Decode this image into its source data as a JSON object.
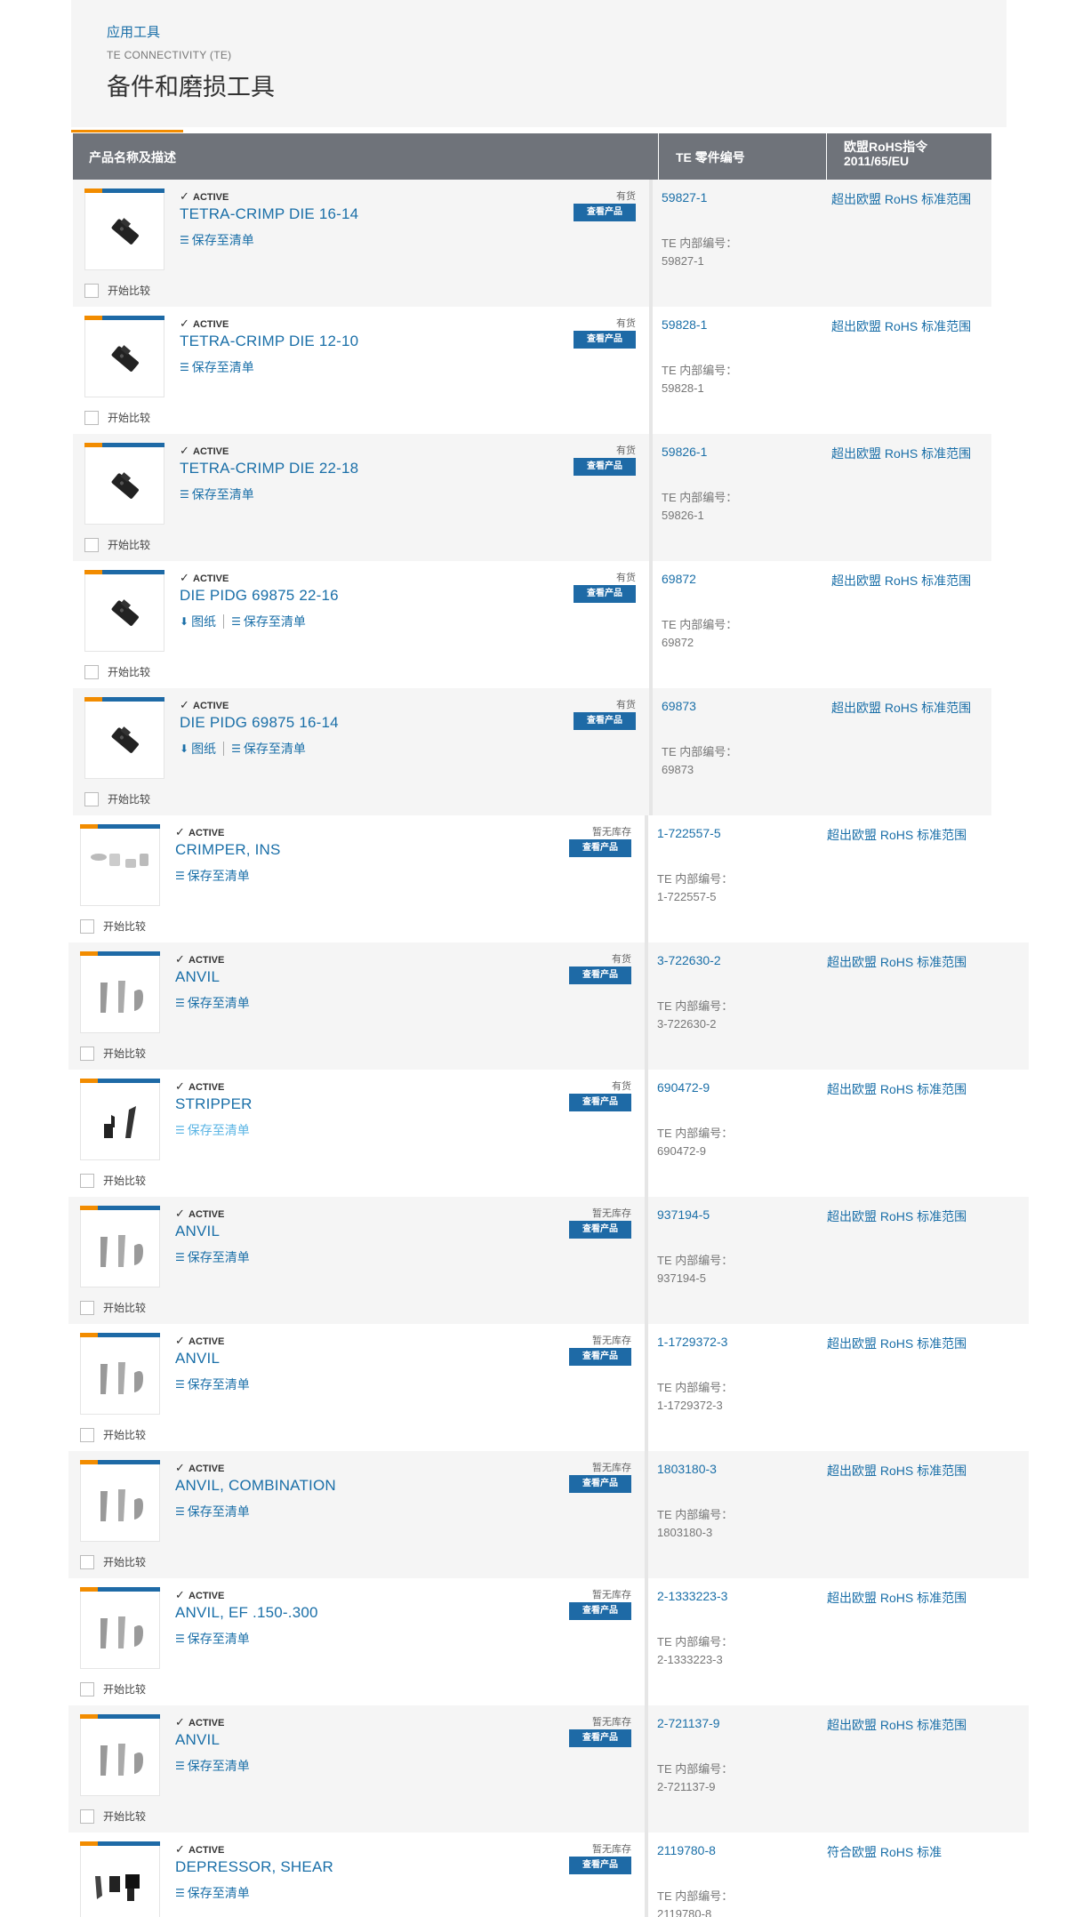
{
  "header": {
    "breadcrumb": "应用工具",
    "brand": "TE CONNECTIVITY (TE)",
    "title": "备件和磨损工具"
  },
  "table": {
    "col_product": "产品名称及描述",
    "col_part": "TE 零件编号",
    "col_rohs_line1": "欧盟RoHS指令",
    "col_rohs_line2": "2011/65/EU"
  },
  "common": {
    "status": "ACTIVE",
    "view_button": "查看产品",
    "save_to_list": "保存至清单",
    "drawing": "图纸",
    "compare": "开始比较",
    "internal_label": "TE 内部编号："
  },
  "rows": [
    {
      "name": "TETRA-CRIMP DIE 16-14",
      "stock": "有货",
      "part": "59827-1",
      "internal": "59827-1",
      "rohs": "超出欧盟 RoHS 标准范围",
      "image": "die-icon",
      "drawing": false
    },
    {
      "name": "TETRA-CRIMP DIE 12-10",
      "stock": "有货",
      "part": "59828-1",
      "internal": "59828-1",
      "rohs": "超出欧盟 RoHS 标准范围",
      "image": "die-icon",
      "drawing": false
    },
    {
      "name": "TETRA-CRIMP DIE 22-18",
      "stock": "有货",
      "part": "59826-1",
      "internal": "59826-1",
      "rohs": "超出欧盟 RoHS 标准范围",
      "image": "die-icon",
      "drawing": false
    },
    {
      "name": "DIE PIDG 69875 22-16",
      "stock": "有货",
      "part": "69872",
      "internal": "69872",
      "rohs": "超出欧盟 RoHS 标准范围",
      "image": "die-icon",
      "drawing": true
    },
    {
      "name": "DIE PIDG 69875 16-14",
      "stock": "有货",
      "part": "69873",
      "internal": "69873",
      "rohs": "超出欧盟 RoHS 标准范围",
      "image": "die-icon",
      "drawing": true
    },
    {
      "name": "CRIMPER, INS",
      "stock": "暂无库存",
      "part": "1-722557-5",
      "internal": "1-722557-5",
      "rohs": "超出欧盟 RoHS 标准范围",
      "image": "crimper-parts-icon",
      "drawing": false
    },
    {
      "name": "ANVIL",
      "stock": "有货",
      "part": "3-722630-2",
      "internal": "3-722630-2",
      "rohs": "超出欧盟 RoHS 标准范围",
      "image": "anvil-icon",
      "drawing": false
    },
    {
      "name": "STRIPPER",
      "stock": "有货",
      "part": "690472-9",
      "internal": "690472-9",
      "rohs": "超出欧盟 RoHS 标准范围",
      "image": "stripper-icon",
      "drawing": false
    },
    {
      "name": "ANVIL",
      "stock": "暂无库存",
      "part": "937194-5",
      "internal": "937194-5",
      "rohs": "超出欧盟 RoHS 标准范围",
      "image": "anvil-icon",
      "drawing": false
    },
    {
      "name": "ANVIL",
      "stock": "暂无库存",
      "part": "1-1729372-3",
      "internal": "1-1729372-3",
      "rohs": "超出欧盟 RoHS 标准范围",
      "image": "anvil-icon",
      "drawing": false
    },
    {
      "name": "ANVIL, COMBINATION",
      "stock": "暂无库存",
      "part": "1803180-3",
      "internal": "1803180-3",
      "rohs": "超出欧盟 RoHS 标准范围",
      "image": "anvil-icon",
      "drawing": false
    },
    {
      "name": "ANVIL, EF .150-.300",
      "stock": "暂无库存",
      "part": "2-1333223-3",
      "internal": "2-1333223-3",
      "rohs": "超出欧盟 RoHS 标准范围",
      "image": "anvil-icon",
      "drawing": false
    },
    {
      "name": "ANVIL",
      "stock": "暂无库存",
      "part": "2-721137-9",
      "internal": "2-721137-9",
      "rohs": "超出欧盟 RoHS 标准范围",
      "image": "anvil-icon",
      "drawing": false
    },
    {
      "name": "DEPRESSOR, SHEAR",
      "stock": "暂无库存",
      "part": "2119780-8",
      "internal": "2119780-8",
      "rohs": "符合欧盟 RoHS 标准",
      "image": "shear-parts-icon",
      "drawing": false
    }
  ]
}
